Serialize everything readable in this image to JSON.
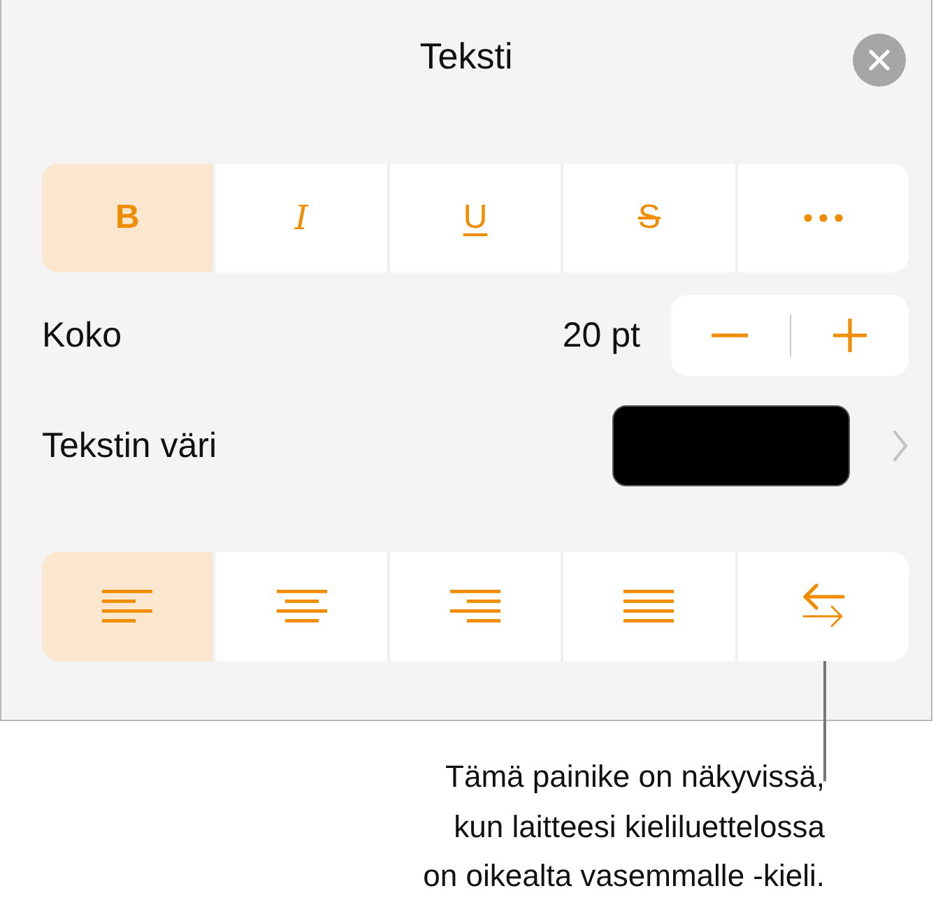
{
  "panel": {
    "title": "Teksti"
  },
  "styles": [
    {
      "kind": "bold",
      "label": "B",
      "selected": true
    },
    {
      "kind": "italic",
      "label": "I",
      "selected": false
    },
    {
      "kind": "underline",
      "label": "U",
      "selected": false
    },
    {
      "kind": "strike",
      "label": "S",
      "selected": false
    },
    {
      "kind": "more",
      "selected": false
    }
  ],
  "size": {
    "label": "Koko",
    "value": "20 pt"
  },
  "text_color": {
    "label": "Tekstin väri",
    "color": "#000000"
  },
  "alignment": [
    {
      "kind": "left",
      "selected": true
    },
    {
      "kind": "center",
      "selected": false
    },
    {
      "kind": "right",
      "selected": false
    },
    {
      "kind": "justify",
      "selected": false
    },
    {
      "kind": "direction",
      "selected": false
    }
  ],
  "callout": "Tämä painike on näkyvissä,\nkun laitteesi kieliluettelossa\non oikealta vasemmalle -kieli."
}
